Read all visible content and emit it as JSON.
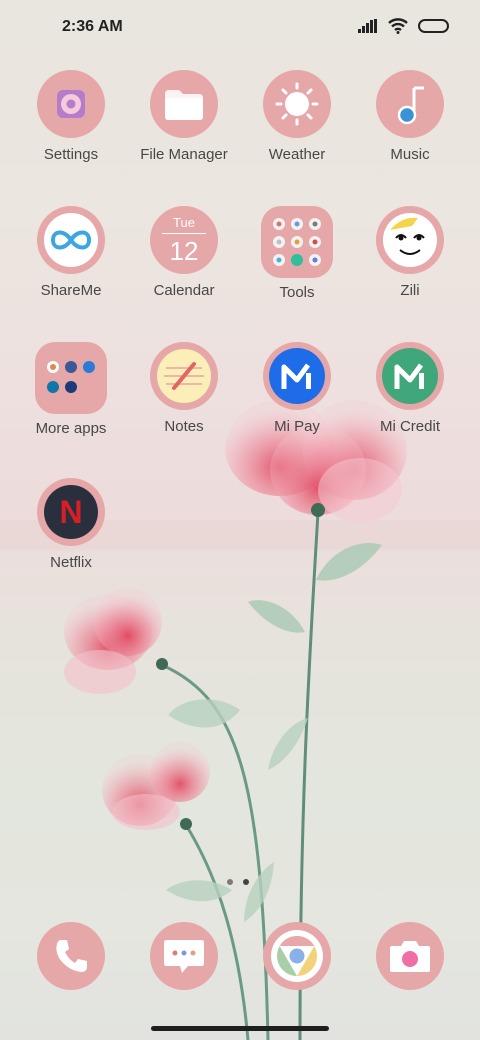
{
  "status_bar": {
    "time": "2:36 AM",
    "icons": [
      "signal-icon",
      "wifi-icon",
      "battery-icon"
    ]
  },
  "apps": [
    {
      "label": "Settings",
      "icon": "settings-icon"
    },
    {
      "label": "File Manager",
      "icon": "folder-icon"
    },
    {
      "label": "Weather",
      "icon": "sun-icon"
    },
    {
      "label": "Music",
      "icon": "music-note-icon"
    },
    {
      "label": "ShareMe",
      "icon": "infinity-icon"
    },
    {
      "label": "Calendar",
      "icon": "calendar-icon",
      "day": "Tue",
      "date": "12"
    },
    {
      "label": "Tools",
      "icon": "tools-folder-icon"
    },
    {
      "label": "Zili",
      "icon": "zili-face-icon"
    },
    {
      "label": "More apps",
      "icon": "apps-folder-icon"
    },
    {
      "label": "Notes",
      "icon": "notes-icon"
    },
    {
      "label": "Mi Pay",
      "icon": "mi-pay-icon"
    },
    {
      "label": "Mi Credit",
      "icon": "mi-credit-icon"
    },
    {
      "label": "Netflix",
      "icon": "netflix-icon",
      "glyph": "N"
    }
  ],
  "dock": [
    {
      "name": "phone",
      "icon": "phone-icon"
    },
    {
      "name": "messages",
      "icon": "message-icon"
    },
    {
      "name": "chrome",
      "icon": "chrome-icon"
    },
    {
      "name": "camera",
      "icon": "camera-icon"
    }
  ],
  "page_indicator": {
    "pages": 2,
    "current": 2
  },
  "colors": {
    "icon_background": "#e6a7a9",
    "text": "#474747",
    "mi_pay_blue": "#1e6ce8",
    "mi_credit_green": "#3fa77a",
    "netflix_red": "#d81f26"
  }
}
